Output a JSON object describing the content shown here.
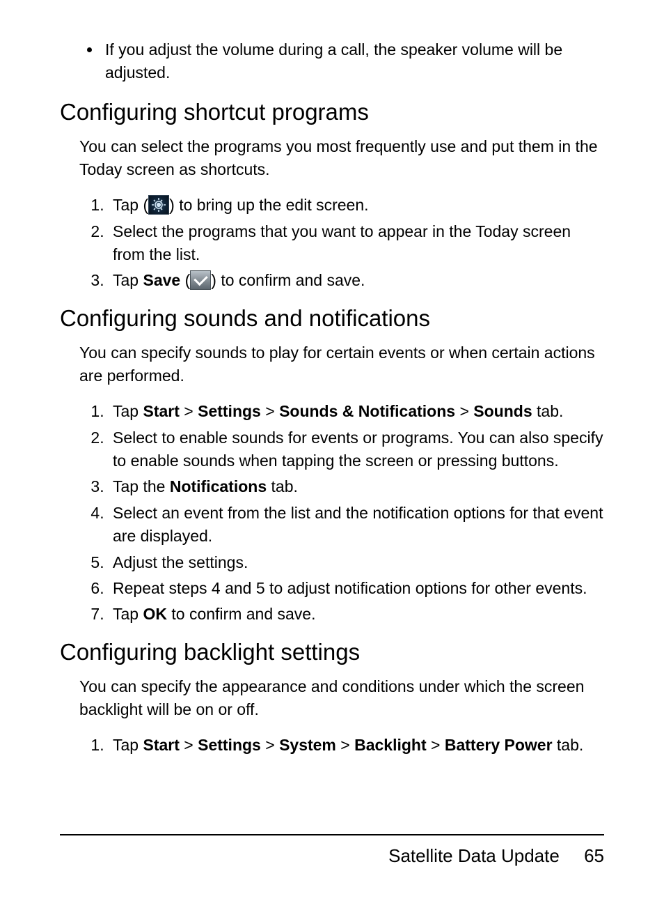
{
  "intro_bullet": "If you adjust the volume during a call, the speaker volume will be adjusted.",
  "sections": {
    "shortcut": {
      "heading": "Configuring shortcut programs",
      "intro": "You can select the programs you most frequently use and put them in the Today screen as shortcuts.",
      "steps": {
        "s1a": "Tap (",
        "s1b": ") to bring up the edit screen.",
        "s2": "Select the programs that you want to appear in the Today screen from the list.",
        "s3a": "Tap ",
        "s3_save": "Save",
        "s3b": " (",
        "s3c": ") to confirm and save."
      }
    },
    "sounds": {
      "heading": "Configuring sounds and notifications",
      "intro": "You can specify sounds to play for certain events or when certain actions are performed.",
      "steps": {
        "s1a": "Tap ",
        "s1_start": "Start",
        "sep": " > ",
        "s1_settings": "Settings",
        "s1_sn": "Sounds & Notifications",
        "s1_sounds": "Sounds",
        "s1b": " tab.",
        "s2": "Select to enable sounds for events or programs. You can also specify to enable sounds when tapping the screen or pressing buttons.",
        "s3a": "Tap the ",
        "s3_notif": "Notifications",
        "s3b": " tab.",
        "s4": "Select an event from the list and the notification options for that event are displayed.",
        "s5": "Adjust the settings.",
        "s6": "Repeat steps 4 and 5 to adjust notification options for other events.",
        "s7a": "Tap ",
        "s7_ok": "OK",
        "s7b": " to confirm and save."
      }
    },
    "backlight": {
      "heading": "Configuring backlight settings",
      "intro": "You can specify the appearance and conditions under which the screen backlight will be on or off.",
      "steps": {
        "s1a": "Tap ",
        "s1_start": "Start",
        "sep": " > ",
        "s1_settings": "Settings",
        "s1_system": "System",
        "s1_backlight": "Backlight",
        "s1_battery": "Battery Power",
        "s1b": " tab."
      }
    }
  },
  "footer": {
    "title": "Satellite Data Update",
    "page": "65"
  }
}
